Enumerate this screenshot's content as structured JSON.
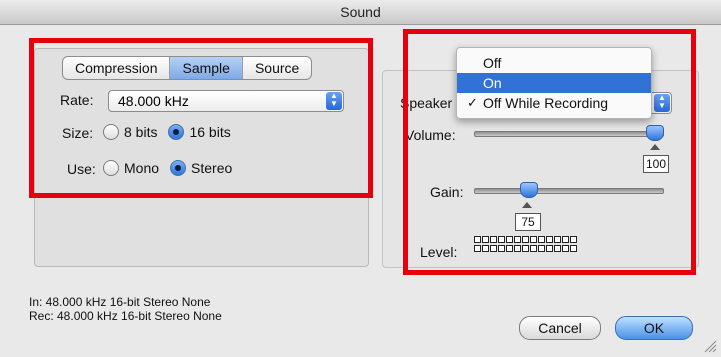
{
  "window": {
    "title": "Sound"
  },
  "left": {
    "tabs": [
      {
        "label": "Compression",
        "active": false
      },
      {
        "label": "Sample",
        "active": true
      },
      {
        "label": "Source",
        "active": false
      }
    ],
    "rate_label": "Rate:",
    "rate_value": "48.000 kHz",
    "size_label": "Size:",
    "size_options": [
      {
        "label": "8 bits",
        "selected": false
      },
      {
        "label": "16 bits",
        "selected": true
      }
    ],
    "use_label": "Use:",
    "use_options": [
      {
        "label": "Mono",
        "selected": false
      },
      {
        "label": "Stereo",
        "selected": true
      }
    ]
  },
  "right": {
    "speaker_label": "Speaker",
    "speaker_menu": {
      "items": [
        {
          "label": "Off",
          "highlighted": false,
          "checked": false
        },
        {
          "label": "On",
          "highlighted": true,
          "checked": false
        },
        {
          "label": "Off While Recording",
          "highlighted": false,
          "checked": true
        }
      ],
      "check_glyph": "✓"
    },
    "volume_label": "Volume:",
    "volume_value": "100",
    "gain_label": "Gain:",
    "gain_value": "75",
    "level_label": "Level:"
  },
  "status": {
    "in_line": "In: 48.000 kHz 16-bit Stereo None",
    "rec_line": "Rec: 48.000 kHz 16-bit Stereo None"
  },
  "buttons": {
    "cancel": "Cancel",
    "ok": "OK"
  },
  "colors": {
    "highlight_red": "#e6000d",
    "accent_blue": "#3272d6"
  }
}
